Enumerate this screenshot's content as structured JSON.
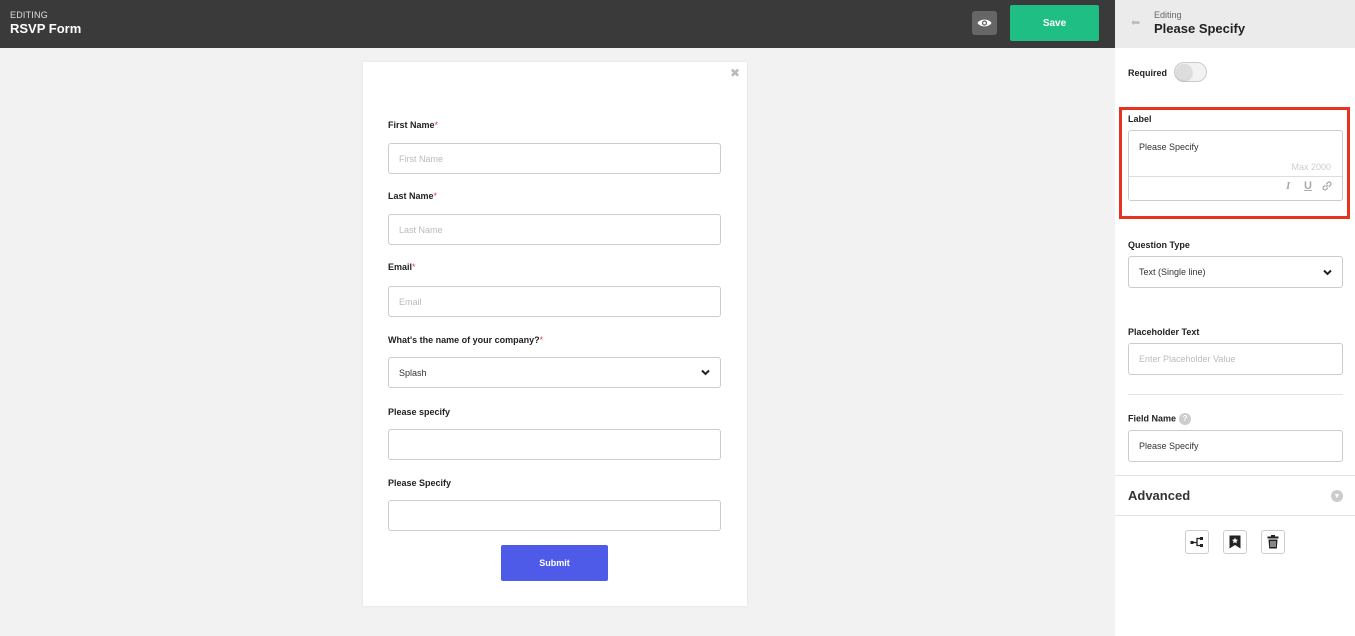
{
  "header": {
    "editing_label": "EDITING",
    "form_title": "RSVP Form",
    "save_label": "Save"
  },
  "form": {
    "fields": [
      {
        "label": "First Name",
        "required_mark": "*",
        "placeholder": "First Name"
      },
      {
        "label": "Last Name",
        "required_mark": "*",
        "placeholder": "Last Name"
      },
      {
        "label": "Email",
        "required_mark": "*",
        "placeholder": "Email"
      },
      {
        "label": "What's the name of your company?",
        "required_mark": "*",
        "value": "Splash"
      },
      {
        "label": "Please specify",
        "value": ""
      },
      {
        "label": "Please Specify",
        "value": ""
      }
    ],
    "submit_label": "Submit"
  },
  "panel": {
    "sub_label": "Editing",
    "title": "Please Specify",
    "required_label": "Required",
    "required_on": false,
    "label_heading": "Label",
    "label_value": "Please Specify",
    "label_max": "Max 2000",
    "question_type_heading": "Question Type",
    "question_type_value": "Text (Single line)",
    "placeholder_heading": "Placeholder Text",
    "placeholder_input_placeholder": "Enter Placeholder Value",
    "field_name_heading": "Field Name",
    "field_name_value": "Please Specify",
    "advanced_label": "Advanced"
  },
  "colors": {
    "topbar": "#3a3a3a",
    "save": "#1fbe84",
    "submit": "#4e5be8",
    "required": "#e0454a",
    "highlight": "#e6331f"
  }
}
